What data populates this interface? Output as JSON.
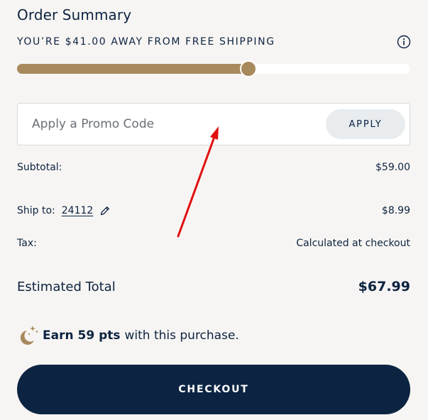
{
  "summary": {
    "title": "Order Summary",
    "shipping_message": "YOU’RE $41.00 AWAY FROM FREE SHIPPING",
    "shipping_progress": 0.59
  },
  "promo": {
    "placeholder": "Apply a Promo Code",
    "value": "",
    "apply_label": "APPLY"
  },
  "lines": {
    "subtotal_label": "Subtotal:",
    "subtotal_value": "$59.00",
    "ship_label": "Ship to:",
    "ship_zip": "24112",
    "ship_value": "$8.99",
    "tax_label": "Tax:",
    "tax_value": "Calculated at checkout"
  },
  "total": {
    "label": "Estimated Total",
    "value": "$67.99"
  },
  "rewards": {
    "points_strong": "Earn 59 pts",
    "points_rest": "with this purchase."
  },
  "checkout": {
    "label": "CHECKOUT"
  },
  "colors": {
    "navy": "#0c2442",
    "gold": "#a7895c",
    "background": "#f7f5f3",
    "annotation_arrow": "#e01010"
  },
  "icons": {
    "info": "info-icon",
    "edit": "pencil-icon",
    "rewards": "moon-stars-icon"
  }
}
